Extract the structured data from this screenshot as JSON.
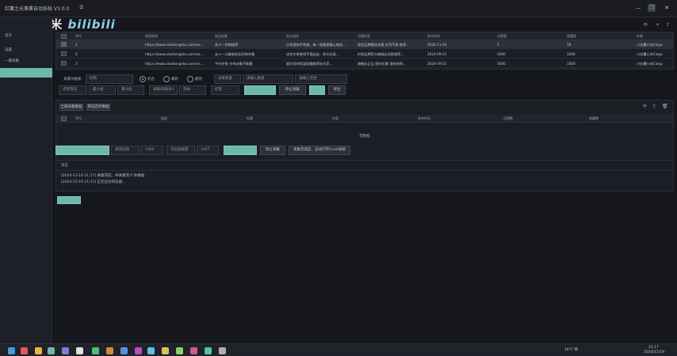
{
  "window": {
    "title": "红薯之光秉秉自动系统 V3.0.0",
    "menu_glyph": "☰"
  },
  "watermark": {
    "text": "渡鸦-小米",
    "brand": "bilibili"
  },
  "window_controls": {
    "minimize": "—",
    "maximize": "❐",
    "close": "✕"
  },
  "sidebar": {
    "items": [
      {
        "label": "首页"
      },
      {
        "label": "设置"
      },
      {
        "label": "一键采集"
      },
      {
        "label": "·"
      }
    ]
  },
  "top_table": {
    "columns": [
      "序号",
      "商品链接",
      "商品标题",
      "卖点描述",
      "品牌信息",
      "发布时间",
      "点赞量",
      "收藏量",
      "作者"
    ],
    "rows": [
      [
        "1",
        "https://www.xiaohongshu.com/ex...",
        "双十一好物推荐",
        "日常温和不刺激，每一瓶都是精心挑选...",
        "国货品牌精选合集 好用不贵 推荐...",
        "2024-11-20",
        "5",
        "16",
        "小红薯小米Calyp"
      ],
      [
        "2",
        "https://www.xiaohongshu.com/ex...",
        "五十一元最新低价好物合集",
        "适合冬季使用不易起皮，性价比高...",
        "护肤品牌官方旗舰店同款推荐...",
        "2024-09-21",
        "5000",
        "1000",
        "小红薯小米Calyp"
      ],
      [
        "3",
        "https://www.xiaohongshu.com/ex...",
        "平价护肤 冬季必备不踩雷",
        "超好用的保湿面霜推荐给大家...",
        "旗舰店正品 限时优惠 速来抢购...",
        "2024-09-21",
        "5000",
        "1000",
        "小红薯小米Calyp"
      ]
    ]
  },
  "toolbar_icons": {
    "refresh": "⟳",
    "add": "+",
    "upload": "⇪",
    "delete": "🗑"
  },
  "form": {
    "keyword_label": "关键词搜索",
    "keyword_value": "好物",
    "radio_options": [
      {
        "label": "综合"
      },
      {
        "label": "最新"
      },
      {
        "label": "最热"
      }
    ],
    "count_label": "采集数量",
    "count_placeholder": "请输入数量",
    "range_placeholder": "请输入范围",
    "collect_label": "点赞筛选",
    "collect_min_placeholder": "最小值",
    "collect_max_placeholder": "最大值",
    "interval_label": "采集间隔(秒)",
    "interval_from": "开始",
    "interval_to": "结束",
    "button_collect": "停止采集",
    "button_stop": "导出"
  },
  "bottom_table": {
    "tabs": [
      "全部采集数据",
      "筛选后的数据"
    ],
    "columns": [
      "序号",
      "链接",
      "标题",
      "内容",
      "发布时间",
      "点赞数",
      "收藏数"
    ],
    "empty_text": "无数据"
  },
  "actions": {
    "thread_label": "请求间隔",
    "thread_value": "1000",
    "retry_label": "浏览器数量",
    "retry_value": "1467",
    "button_start": "停止采集",
    "button_open": "采集完成后，自动打开Excel表格"
  },
  "log": {
    "title": "日志",
    "lines": [
      "[2024-11-19 21:17] 采集完成，共采集到 0 条数据",
      "[2024-11-19 21:17] 正在启动浏览器..."
    ]
  },
  "taskbar": {
    "tray_text": "16°C 晴",
    "time": "21:17",
    "date": "2024/11/19",
    "icon_colors": [
      "#3aa0e0",
      "#e05a5a",
      "#e8b54a",
      "#6cb8ac",
      "#7a7fd0",
      "#e0e0e0",
      "#4fc06a",
      "#d88a3c",
      "#5a8fe0",
      "#c04ac0",
      "#60c0e0",
      "#e0c050",
      "#8ad070",
      "#d05a8a",
      "#5ac0b0",
      "#b0b0b0"
    ]
  },
  "colors": {
    "accent": "#6cb8ac",
    "background": "#15171d",
    "panel": "#1b1e25"
  }
}
